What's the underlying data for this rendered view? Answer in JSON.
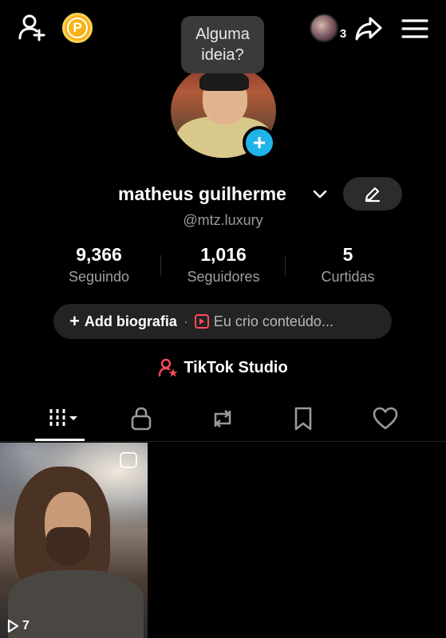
{
  "tooltip": {
    "text": "Alguma ideia?"
  },
  "topbar": {
    "coin_letter": "P",
    "friends_count": "3"
  },
  "profile": {
    "name": "matheus guilherme",
    "handle": "@mtz.luxury"
  },
  "stats": [
    {
      "value": "9,366",
      "label": "Seguindo"
    },
    {
      "value": "1,016",
      "label": "Seguidores"
    },
    {
      "value": "5",
      "label": "Curtidas"
    }
  ],
  "bio": {
    "add_label": "Add biografia",
    "separator": "·",
    "creator_label": "Eu crio conteúdo..."
  },
  "studio": {
    "label": "TikTok Studio"
  },
  "tabs": [
    "videos-grid",
    "private",
    "reposts",
    "favorites",
    "liked"
  ],
  "videos": [
    {
      "views": "7"
    }
  ],
  "colors": {
    "accent_blue": "#20b3e8",
    "coin_gold": "#f6b318",
    "studio_red": "#ff4a5a",
    "pill_bg": "#232323"
  }
}
